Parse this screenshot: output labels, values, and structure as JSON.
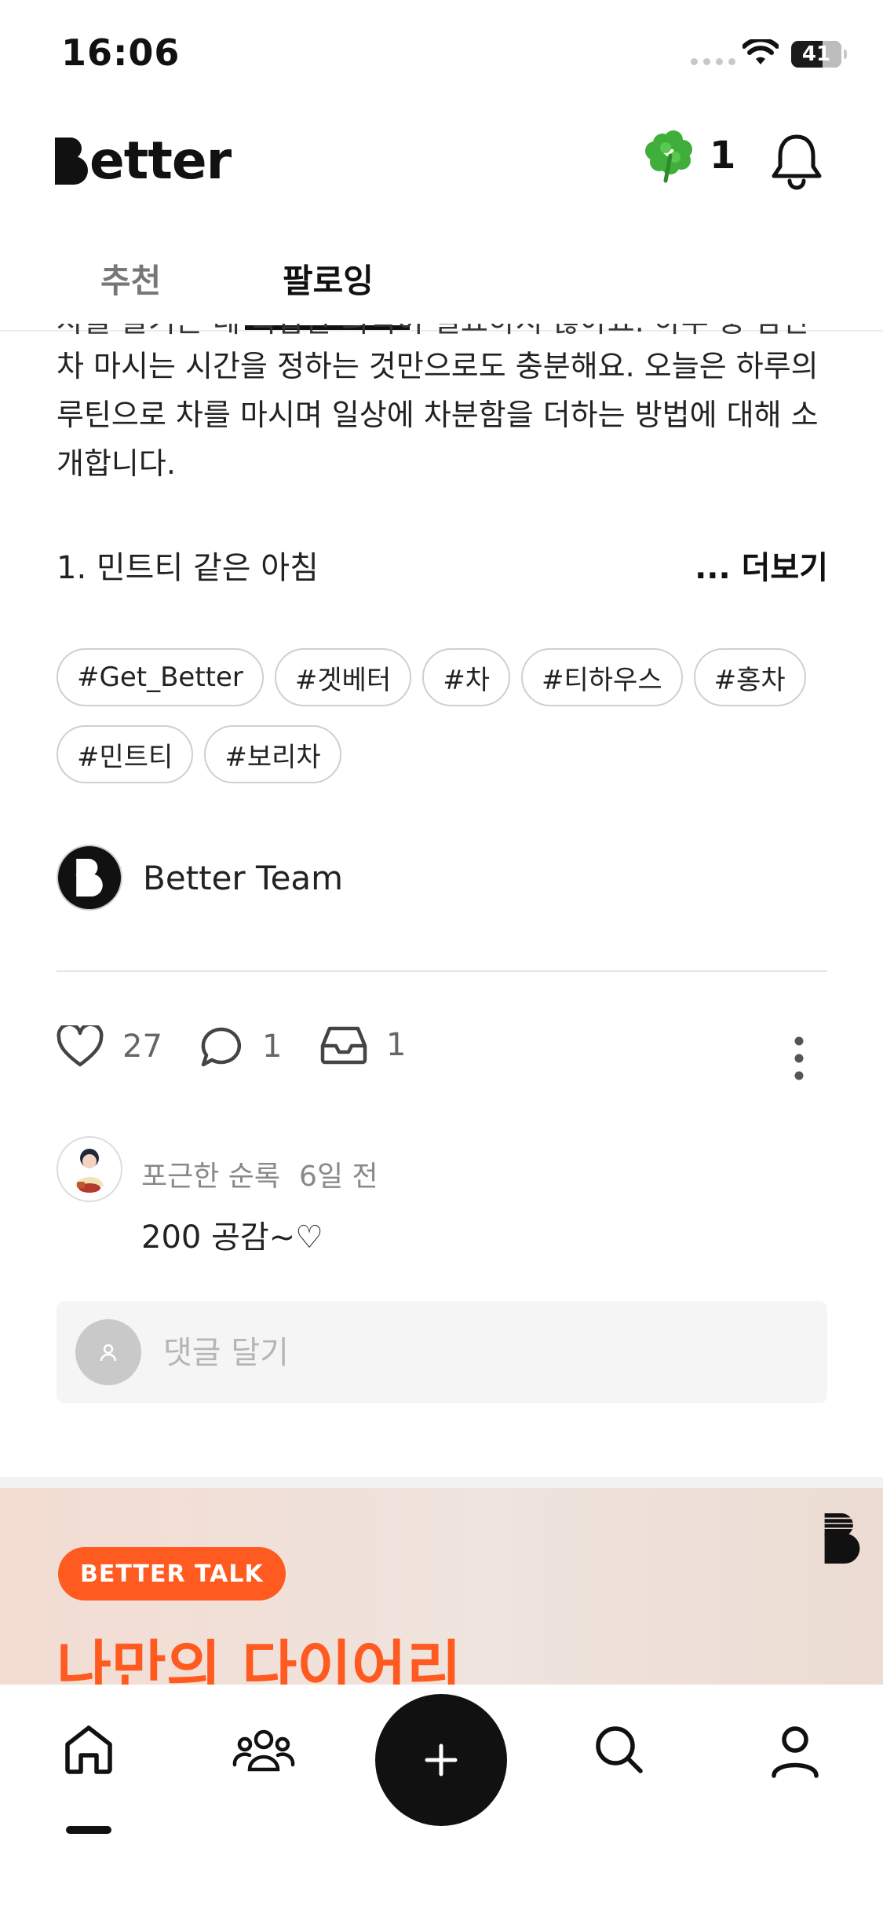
{
  "status_bar": {
    "time": "16:06",
    "battery": "41"
  },
  "header": {
    "logo_text": "etter",
    "clover_count": "1"
  },
  "tabs": [
    {
      "label": "추천",
      "active": false
    },
    {
      "label": "팔로잉",
      "active": true
    }
  ],
  "post": {
    "clipped_line": "차를 즐기는 데 복잡한 의식이 필요하지 않아요. 하루 중 잠깐이라도",
    "body": "차 마시는 시간을 정하는 것만으로도 충분해요. 오늘은 하루의 루틴으로 차를 마시며 일상에 차분함을 더하는 방법에 대해 소개합니다.",
    "numbered_line": "1. 민트티 같은 아침",
    "more_label": "... 더보기",
    "tags_row1": [
      "#Get_Better",
      "#겟베터",
      "#차",
      "#티하우스",
      "#홍차"
    ],
    "tags_row2": [
      "#민트티",
      "#보리차"
    ],
    "author": "Better Team"
  },
  "actions": {
    "likes": "27",
    "comments": "1",
    "saves": "1"
  },
  "comment": {
    "user": "포근한 순록",
    "time": "6일 전",
    "text": "200 공감~♡"
  },
  "reply": {
    "placeholder": "댓글 달기"
  },
  "banner": {
    "pill": "BETTER TALK",
    "headline": "나만의 다이어리"
  },
  "colors": {
    "accent": "#ff5a1f",
    "text": "#111111",
    "muted": "#888888"
  },
  "nav": [
    {
      "icon": "home-icon"
    },
    {
      "icon": "community-icon"
    },
    {
      "icon": "plus-icon"
    },
    {
      "icon": "search-icon"
    },
    {
      "icon": "profile-icon"
    }
  ]
}
